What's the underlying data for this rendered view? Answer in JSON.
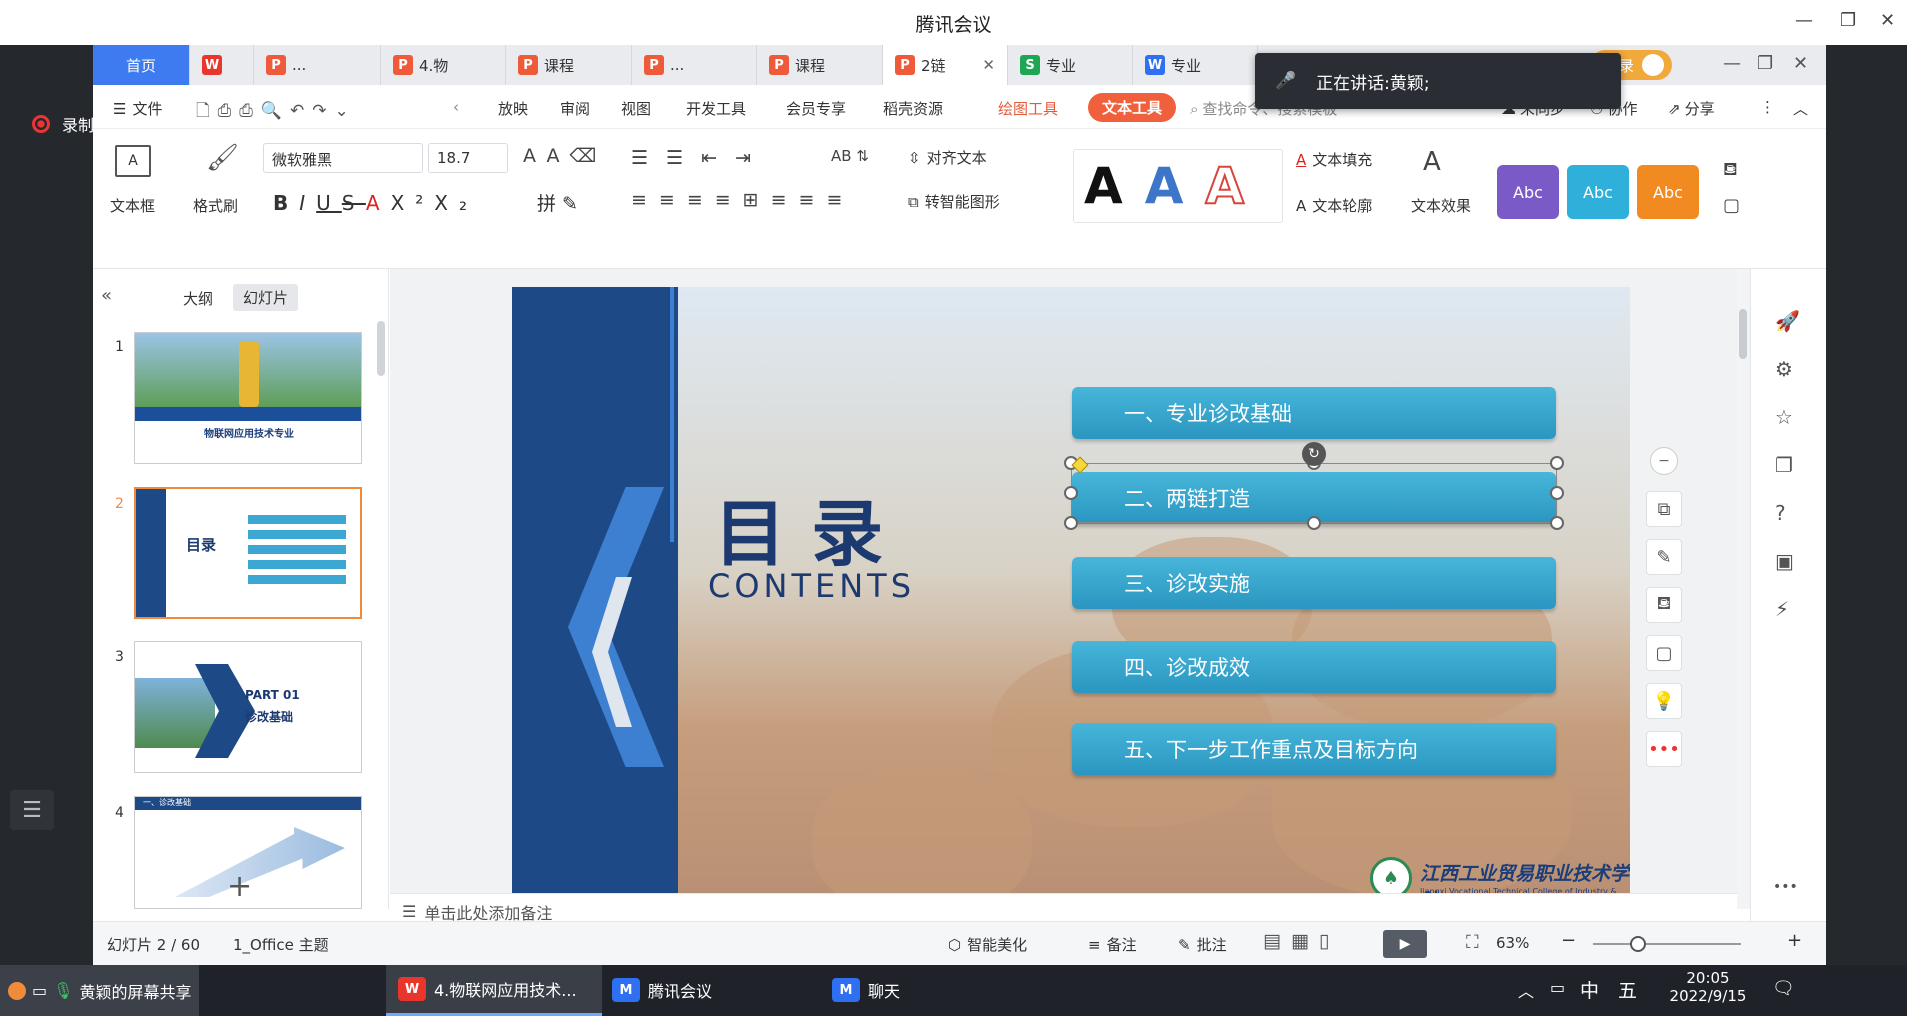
{
  "meeting": {
    "title": "腾讯会议",
    "recording": "录制中",
    "speaking_prefix": "正在讲话: ",
    "speaker": "黄颖;",
    "screen_share": "黄颖的屏幕共享"
  },
  "tabs": [
    {
      "label": "首页",
      "icon": "",
      "color": ""
    },
    {
      "label": "",
      "icon": "W",
      "color": "#e8362d"
    },
    {
      "label": "...",
      "icon": "P",
      "color": "#ee5a3a"
    },
    {
      "label": "4.物",
      "icon": "P",
      "color": "#ee5a3a"
    },
    {
      "label": "课程",
      "icon": "P",
      "color": "#ee5a3a"
    },
    {
      "label": "...",
      "icon": "P",
      "color": "#ee5a3a"
    },
    {
      "label": "课程",
      "icon": "P",
      "color": "#ee5a3a"
    },
    {
      "label": "2链",
      "icon": "P",
      "color": "#ee5a3a"
    },
    {
      "label": "专业",
      "icon": "S",
      "color": "#1fa655"
    },
    {
      "label": "专业",
      "icon": "W",
      "color": "#2f6ff2"
    }
  ],
  "login": "登录",
  "menu": {
    "file": "文件",
    "items": [
      "放映",
      "审阅",
      "视图",
      "开发工具",
      "会员专享",
      "稻壳资源",
      "绘图工具"
    ],
    "active_tab": "文本工具",
    "search": "查找命令、搜索模板",
    "sync": "未同步",
    "collab": "协作",
    "share": "分享"
  },
  "ribbon": {
    "textbox": "文本框",
    "format_painter": "格式刷",
    "font": "微软雅黑",
    "size": "18.7",
    "align_text": "对齐文本",
    "smart_shape": "转智能图形",
    "text_fill": "文本填充",
    "text_outline": "文本轮廓",
    "text_effect": "文本效果",
    "styles": [
      "Abc",
      "Abc",
      "Abc"
    ],
    "big_a": [
      "A",
      "A",
      "A"
    ]
  },
  "panel": {
    "outline": "大纲",
    "slides": "幻灯片",
    "numbers": [
      "1",
      "2",
      "3",
      "4"
    ],
    "thumb1_title": "物联网应用技术专业",
    "thumb2_title": "目录",
    "thumb3_part": "PART 01",
    "thumb3_sub": "诊改基础",
    "thumb4_header": "一、诊改基础"
  },
  "slide": {
    "title": "目 录",
    "subtitle": "CONTENTS",
    "items": [
      "一、专业诊改基础",
      "二、两链打造",
      "三、诊改实施",
      "四、诊改成效",
      "五、下一步工作重点及目标方向"
    ],
    "school_cn": "江西工业贸易职业技术学院",
    "school_en": "Jiangxi Vocational Technical College of Industry & Trade"
  },
  "notes": "单击此处添加备注",
  "status": {
    "slide_count": "幻灯片 2 / 60",
    "theme": "1_Office 主题",
    "beautify": "智能美化",
    "notes": "备注",
    "comment": "批注",
    "zoom": "63%"
  },
  "taskbar": {
    "wps": "4.物联网应用技术...",
    "meeting": "腾讯会议",
    "chat": "聊天",
    "ime1": "中",
    "ime2": "五",
    "time": "20:05",
    "date": "2022/9/15"
  }
}
